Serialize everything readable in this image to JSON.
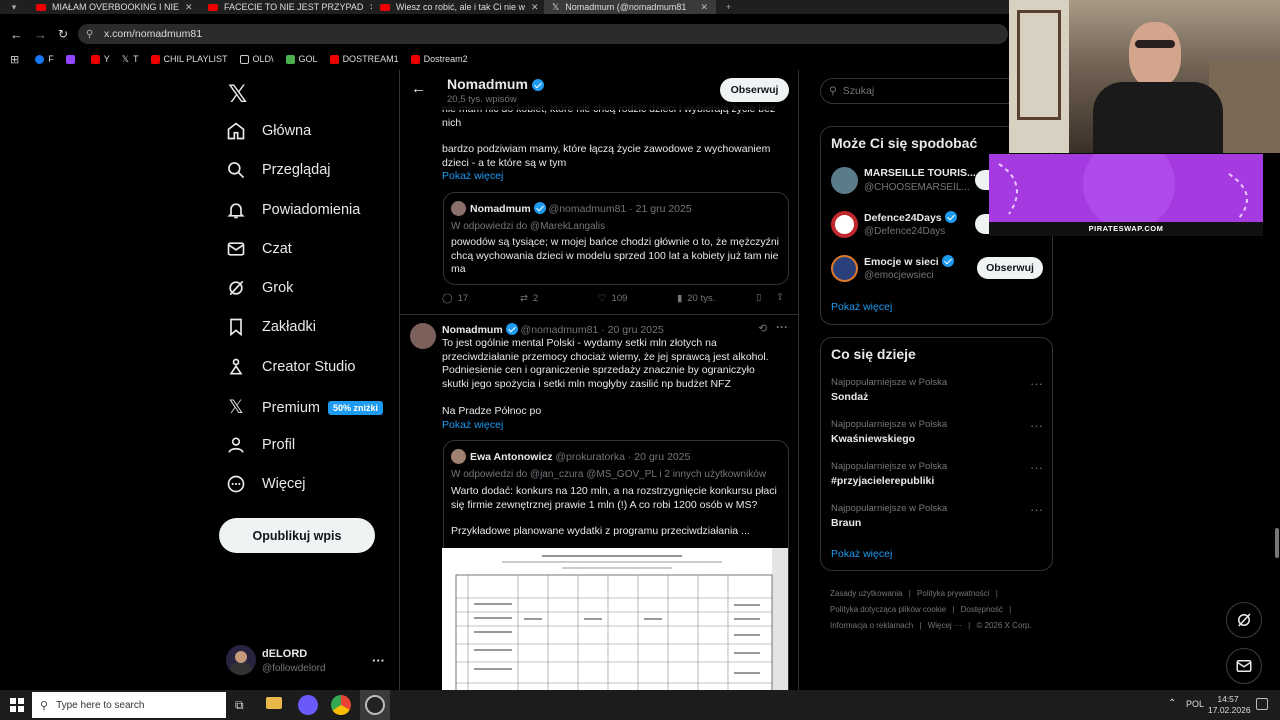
{
  "browser": {
    "tabs": [
      {
        "title": "MIAŁAM OVERBOOKING I NIE",
        "active": false
      },
      {
        "title": "FACECIE TO NIE JEST PRZYPAD",
        "active": false
      },
      {
        "title": "Wiesz co robić, ale i tak Ci nie w",
        "active": false
      },
      {
        "title": "Nomadmum (@nomadmum81",
        "active": true
      }
    ],
    "url": "x.com/nomadmum81",
    "bookmarks": [
      {
        "label": "F",
        "color": "#1877f2"
      },
      {
        "label": "",
        "color": "#9146ff"
      },
      {
        "label": "Y",
        "color": "#e00"
      },
      {
        "label": "T",
        "color": "#ffffff"
      },
      {
        "label": "CHIL PLAYLIST",
        "color": "#e00"
      },
      {
        "label": "OLD\\",
        "color": "#888"
      },
      {
        "label": "GOL",
        "color": "#4caf50"
      },
      {
        "label": "DOSTREAM1",
        "color": "#e00"
      },
      {
        "label": "Dostream2",
        "color": "#e00"
      }
    ]
  },
  "nav": {
    "items": [
      {
        "label": "Główna",
        "icon": "home-icon"
      },
      {
        "label": "Przeglądaj",
        "icon": "search-icon"
      },
      {
        "label": "Powiadomienia",
        "icon": "bell-icon"
      },
      {
        "label": "Czat",
        "icon": "mail-icon"
      },
      {
        "label": "Grok",
        "icon": "grok-icon"
      },
      {
        "label": "Zakładki",
        "icon": "bookmark-icon"
      },
      {
        "label": "Creator Studio",
        "icon": "creator-icon"
      },
      {
        "label": "Premium",
        "icon": "x-icon"
      },
      {
        "label": "Profil",
        "icon": "user-icon"
      },
      {
        "label": "Więcej",
        "icon": "more-circle-icon"
      }
    ],
    "premium_badge": "50% zniżki",
    "post_button": "Opublikuj wpis",
    "account": {
      "name": "dELORD",
      "handle": "@followdelord"
    }
  },
  "header": {
    "name": "Nomadmum",
    "posts_count": "20,5 tys. wpisów",
    "follow": "Obserwuj"
  },
  "tweet1": {
    "text_top": "nie mam nic do kobiet,  które nie chcą rodzić dzieci i wybierają życie bez nich",
    "text2": "bardzo podziwiam mamy,  które łączą życie zawodowe z wychowaniem dzieci - a te które są w tym",
    "show_more": "Pokaż więcej",
    "quote": {
      "name": "Nomadmum",
      "meta": "@nomadmum81 · 21 gru 2025",
      "reply_to": "W odpowiedzi do @MarekLangalis",
      "text": "powodów są tysiące; w mojej bańce chodzi głównie o to, że mężczyźni chcą wychowania dzieci w modelu sprzed 100 lat a kobiety  już tam nie ma"
    },
    "actions": {
      "replies": "17",
      "reposts": "2",
      "likes": "109",
      "views": "20 tys."
    }
  },
  "tweet2": {
    "name": "Nomadmum",
    "meta": "@nomadmum81 · 20 gru 2025",
    "text": "To jest ogólnie mental Polski - wydamy setki mln złotych na przeciwdziałanie przemocy chociaż wiemy,  że jej sprawcą jest alkohol. Podniesienie cen i ograniczenie sprzedaży znacznie by ograniczyło skutki jego spożycia i setki mln mogłyby zasilić np budżet NFZ",
    "text2": "Na Pradze Północ po",
    "show_more": "Pokaż więcej",
    "quote": {
      "name": "Ewa Antonowicz",
      "meta": "@prokuratorka · 20 gru 2025",
      "reply_to": "W odpowiedzi do @jan_czura @MS_GOV_PL  i 2 innych użytkowników",
      "text": "Warto dodać: konkurs na 120 mln, a na rozstrzygnięcie konkursu płaci się firmie zewnętrznej prawie 1 mln (!) A co robi 1200 osób w MS?",
      "text2": "Przykładowe planowane wydatki z programu przeciwdziałania ..."
    }
  },
  "search": {
    "placeholder": "Szukaj"
  },
  "who_to_follow": {
    "title": "Może Ci się spodobać",
    "accounts": [
      {
        "name": "MARSEILLE TOURIS...",
        "handle": "@CHOOSEMARSEIL..."
      },
      {
        "name": "Defence24Days",
        "handle": "@Defence24Days"
      },
      {
        "name": "Emocje w sieci",
        "handle": "@emocjewsieci"
      }
    ],
    "follow": "Obserwuj",
    "show_more": "Pokaż więcej"
  },
  "trends": {
    "title": "Co się dzieje",
    "items": [
      {
        "category": "Najpopularniejsze w Polska",
        "name": "Sondaż"
      },
      {
        "category": "Najpopularniejsze w Polska",
        "name": "Kwaśniewskiego"
      },
      {
        "category": "Najpopularniejsze w Polska",
        "name": "#przyjacielerepubliki"
      },
      {
        "category": "Najpopularniejsze w Polska",
        "name": "Braun"
      }
    ],
    "show_more": "Pokaż więcej"
  },
  "footer": {
    "links": [
      "Zasady użytkowania",
      "Polityka prywatności",
      "Polityka dotycząca plików cookie",
      "Dostępność",
      "Informacja o reklamach",
      "Więcej ···",
      "© 2026 X Corp."
    ]
  },
  "overlay": {
    "banner_text": "PIRATESWAP.COM"
  },
  "taskbar": {
    "search_placeholder": "Type here to search",
    "lang": "POL",
    "time": "14:57",
    "date": "17.02.2026"
  }
}
